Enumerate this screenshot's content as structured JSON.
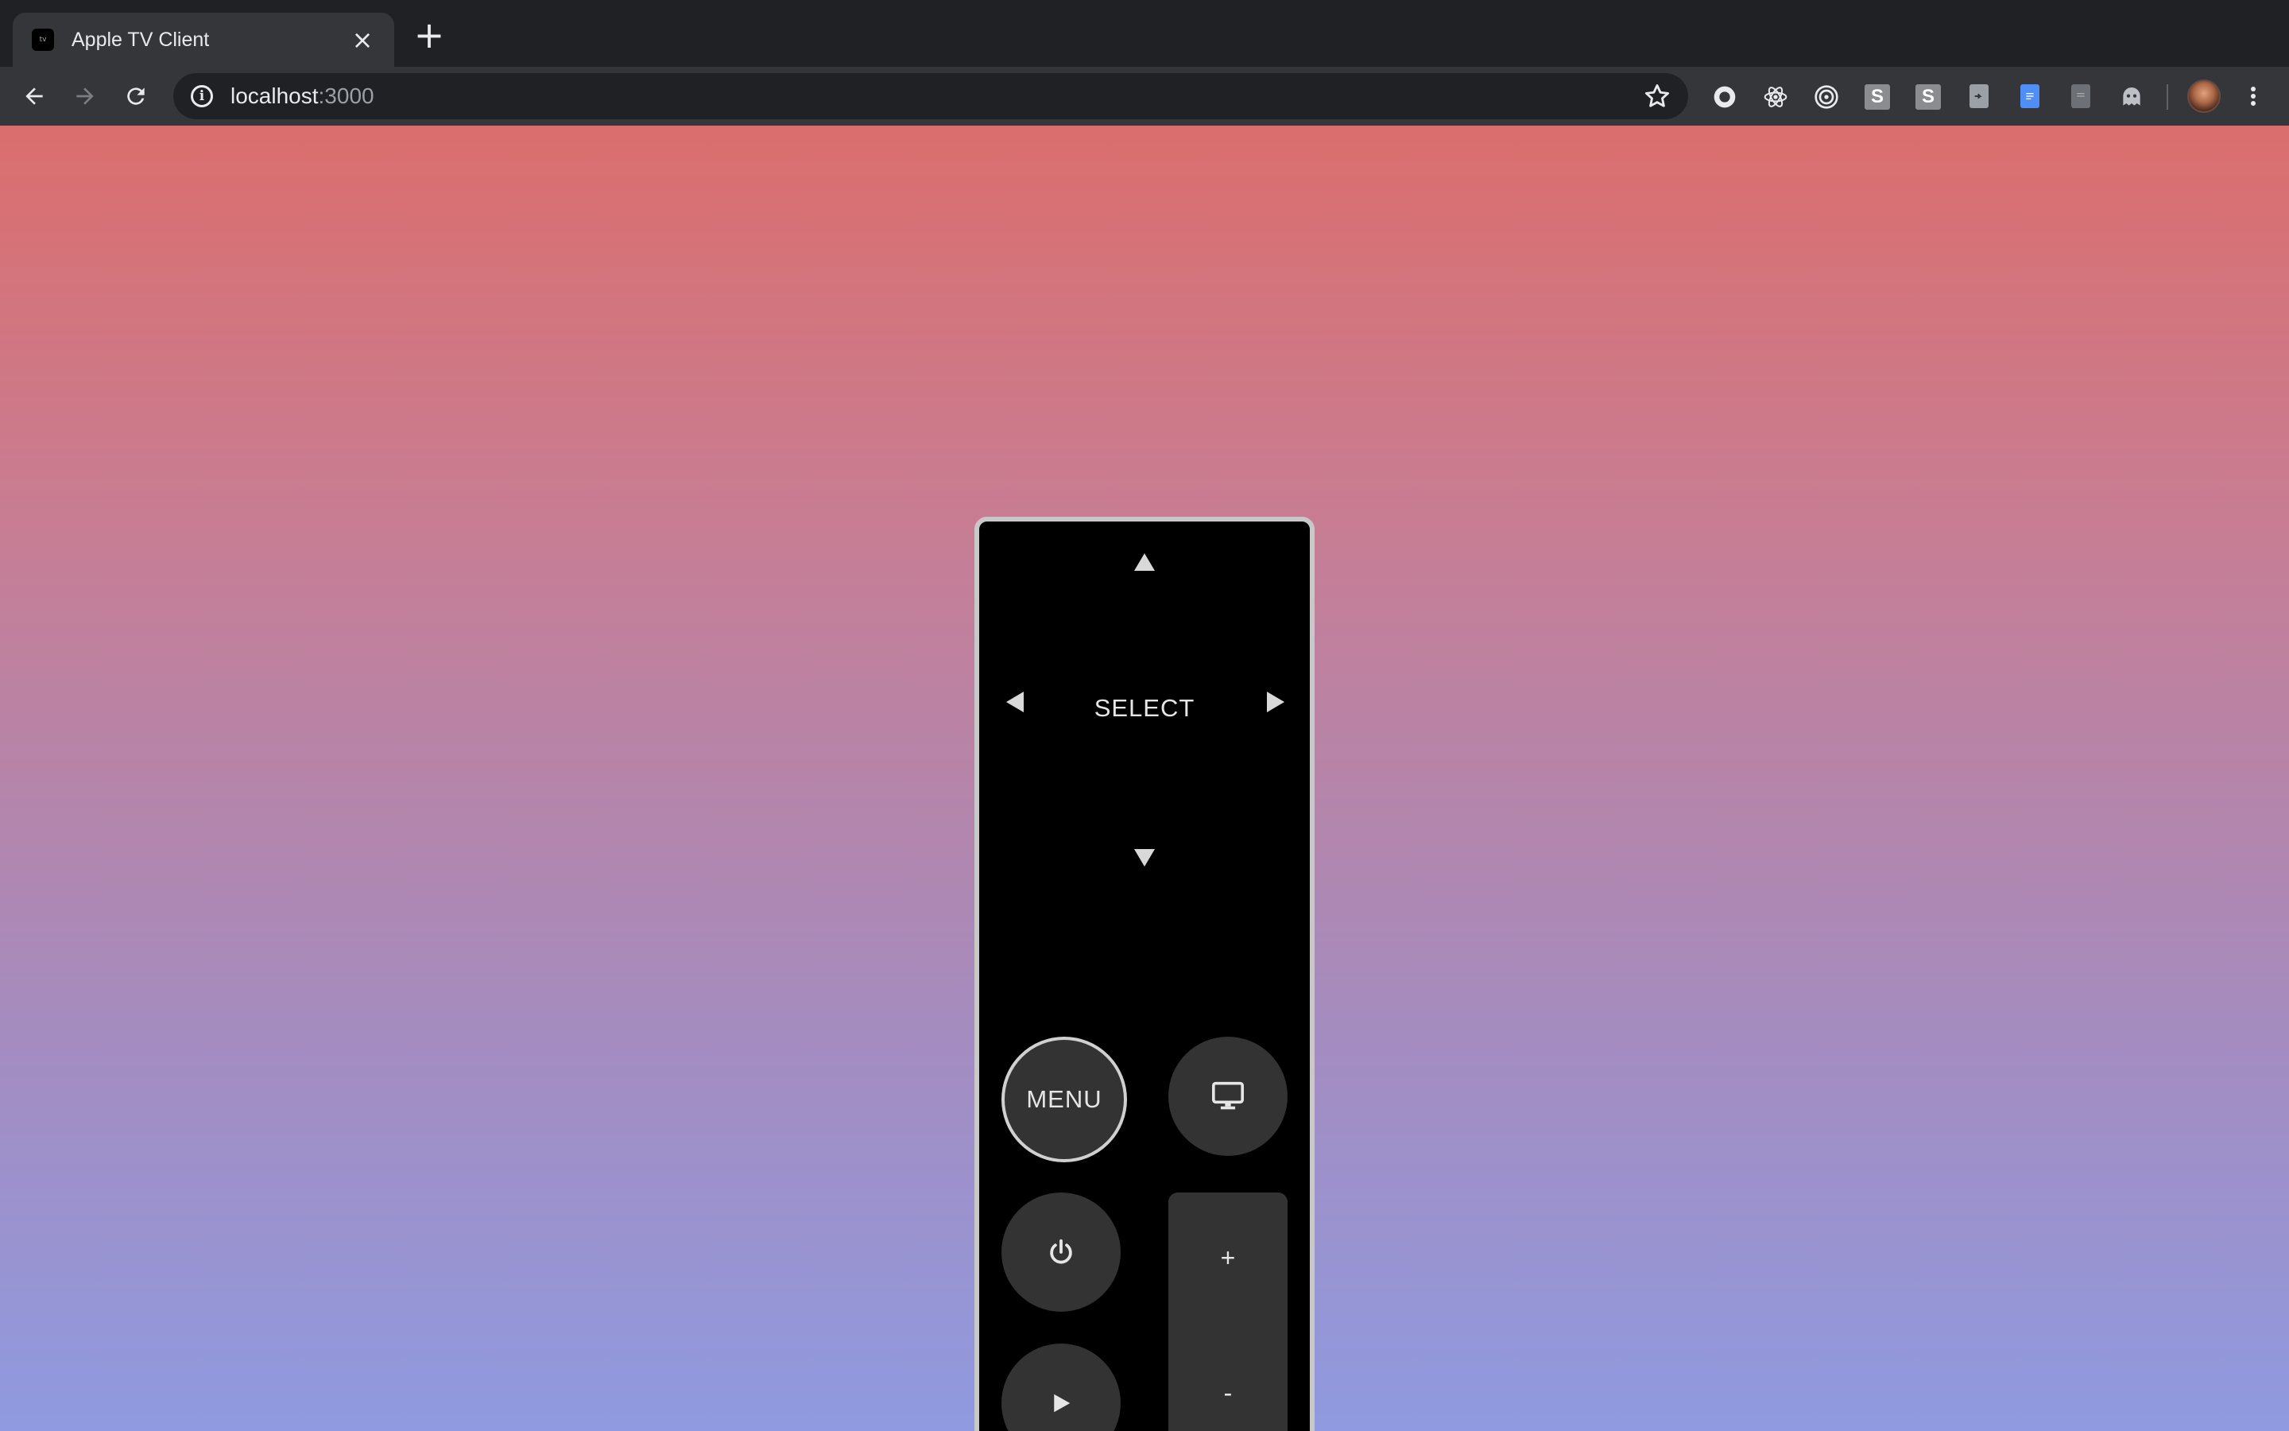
{
  "browser": {
    "tab": {
      "title": "Apple TV Client",
      "favicon_icon": "apple-tv-icon"
    },
    "address": {
      "host": "localhost",
      "port": ":3000"
    },
    "extensions": [
      {
        "icon": "extension-circle-icon"
      },
      {
        "icon": "react-devtools-icon"
      },
      {
        "icon": "target-icon"
      },
      {
        "icon": "extension-s-icon",
        "label": "S"
      },
      {
        "icon": "extension-s-icon",
        "label": "S"
      },
      {
        "icon": "document-icon"
      },
      {
        "icon": "google-doc-icon"
      },
      {
        "icon": "document-gray-icon"
      },
      {
        "icon": "ghost-icon"
      }
    ],
    "accent": "#8ab4f8"
  },
  "remote": {
    "select_label": "SELECT",
    "menu_label": "MENU",
    "volume_up_label": "+",
    "volume_down_label": "-",
    "icons": {
      "up": "arrow-up-icon",
      "down": "arrow-down-icon",
      "left": "arrow-left-icon",
      "right": "arrow-right-icon",
      "tv": "tv-icon",
      "power": "power-icon",
      "play": "play-icon"
    }
  },
  "colors": {
    "gradient_top": "#db6e6d",
    "gradient_bottom": "#8f9ae0",
    "remote_body": "#000000",
    "button_fill": "#333333"
  }
}
